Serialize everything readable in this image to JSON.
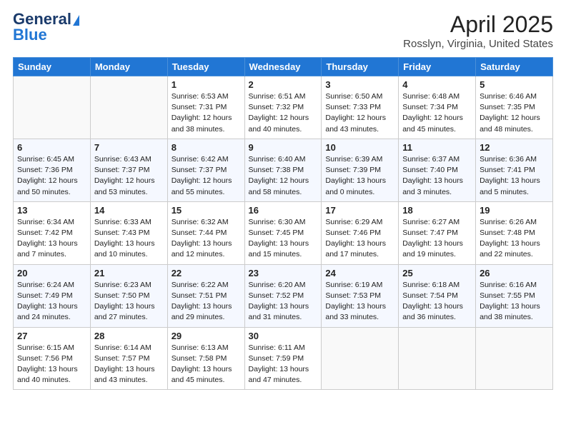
{
  "logo": {
    "general": "General",
    "blue": "Blue"
  },
  "title": {
    "month_year": "April 2025",
    "location": "Rosslyn, Virginia, United States"
  },
  "weekdays": [
    "Sunday",
    "Monday",
    "Tuesday",
    "Wednesday",
    "Thursday",
    "Friday",
    "Saturday"
  ],
  "weeks": [
    [
      {
        "day": "",
        "sunrise": "",
        "sunset": "",
        "daylight": ""
      },
      {
        "day": "",
        "sunrise": "",
        "sunset": "",
        "daylight": ""
      },
      {
        "day": "1",
        "sunrise": "Sunrise: 6:53 AM",
        "sunset": "Sunset: 7:31 PM",
        "daylight": "Daylight: 12 hours and 38 minutes."
      },
      {
        "day": "2",
        "sunrise": "Sunrise: 6:51 AM",
        "sunset": "Sunset: 7:32 PM",
        "daylight": "Daylight: 12 hours and 40 minutes."
      },
      {
        "day": "3",
        "sunrise": "Sunrise: 6:50 AM",
        "sunset": "Sunset: 7:33 PM",
        "daylight": "Daylight: 12 hours and 43 minutes."
      },
      {
        "day": "4",
        "sunrise": "Sunrise: 6:48 AM",
        "sunset": "Sunset: 7:34 PM",
        "daylight": "Daylight: 12 hours and 45 minutes."
      },
      {
        "day": "5",
        "sunrise": "Sunrise: 6:46 AM",
        "sunset": "Sunset: 7:35 PM",
        "daylight": "Daylight: 12 hours and 48 minutes."
      }
    ],
    [
      {
        "day": "6",
        "sunrise": "Sunrise: 6:45 AM",
        "sunset": "Sunset: 7:36 PM",
        "daylight": "Daylight: 12 hours and 50 minutes."
      },
      {
        "day": "7",
        "sunrise": "Sunrise: 6:43 AM",
        "sunset": "Sunset: 7:37 PM",
        "daylight": "Daylight: 12 hours and 53 minutes."
      },
      {
        "day": "8",
        "sunrise": "Sunrise: 6:42 AM",
        "sunset": "Sunset: 7:37 PM",
        "daylight": "Daylight: 12 hours and 55 minutes."
      },
      {
        "day": "9",
        "sunrise": "Sunrise: 6:40 AM",
        "sunset": "Sunset: 7:38 PM",
        "daylight": "Daylight: 12 hours and 58 minutes."
      },
      {
        "day": "10",
        "sunrise": "Sunrise: 6:39 AM",
        "sunset": "Sunset: 7:39 PM",
        "daylight": "Daylight: 13 hours and 0 minutes."
      },
      {
        "day": "11",
        "sunrise": "Sunrise: 6:37 AM",
        "sunset": "Sunset: 7:40 PM",
        "daylight": "Daylight: 13 hours and 3 minutes."
      },
      {
        "day": "12",
        "sunrise": "Sunrise: 6:36 AM",
        "sunset": "Sunset: 7:41 PM",
        "daylight": "Daylight: 13 hours and 5 minutes."
      }
    ],
    [
      {
        "day": "13",
        "sunrise": "Sunrise: 6:34 AM",
        "sunset": "Sunset: 7:42 PM",
        "daylight": "Daylight: 13 hours and 7 minutes."
      },
      {
        "day": "14",
        "sunrise": "Sunrise: 6:33 AM",
        "sunset": "Sunset: 7:43 PM",
        "daylight": "Daylight: 13 hours and 10 minutes."
      },
      {
        "day": "15",
        "sunrise": "Sunrise: 6:32 AM",
        "sunset": "Sunset: 7:44 PM",
        "daylight": "Daylight: 13 hours and 12 minutes."
      },
      {
        "day": "16",
        "sunrise": "Sunrise: 6:30 AM",
        "sunset": "Sunset: 7:45 PM",
        "daylight": "Daylight: 13 hours and 15 minutes."
      },
      {
        "day": "17",
        "sunrise": "Sunrise: 6:29 AM",
        "sunset": "Sunset: 7:46 PM",
        "daylight": "Daylight: 13 hours and 17 minutes."
      },
      {
        "day": "18",
        "sunrise": "Sunrise: 6:27 AM",
        "sunset": "Sunset: 7:47 PM",
        "daylight": "Daylight: 13 hours and 19 minutes."
      },
      {
        "day": "19",
        "sunrise": "Sunrise: 6:26 AM",
        "sunset": "Sunset: 7:48 PM",
        "daylight": "Daylight: 13 hours and 22 minutes."
      }
    ],
    [
      {
        "day": "20",
        "sunrise": "Sunrise: 6:24 AM",
        "sunset": "Sunset: 7:49 PM",
        "daylight": "Daylight: 13 hours and 24 minutes."
      },
      {
        "day": "21",
        "sunrise": "Sunrise: 6:23 AM",
        "sunset": "Sunset: 7:50 PM",
        "daylight": "Daylight: 13 hours and 27 minutes."
      },
      {
        "day": "22",
        "sunrise": "Sunrise: 6:22 AM",
        "sunset": "Sunset: 7:51 PM",
        "daylight": "Daylight: 13 hours and 29 minutes."
      },
      {
        "day": "23",
        "sunrise": "Sunrise: 6:20 AM",
        "sunset": "Sunset: 7:52 PM",
        "daylight": "Daylight: 13 hours and 31 minutes."
      },
      {
        "day": "24",
        "sunrise": "Sunrise: 6:19 AM",
        "sunset": "Sunset: 7:53 PM",
        "daylight": "Daylight: 13 hours and 33 minutes."
      },
      {
        "day": "25",
        "sunrise": "Sunrise: 6:18 AM",
        "sunset": "Sunset: 7:54 PM",
        "daylight": "Daylight: 13 hours and 36 minutes."
      },
      {
        "day": "26",
        "sunrise": "Sunrise: 6:16 AM",
        "sunset": "Sunset: 7:55 PM",
        "daylight": "Daylight: 13 hours and 38 minutes."
      }
    ],
    [
      {
        "day": "27",
        "sunrise": "Sunrise: 6:15 AM",
        "sunset": "Sunset: 7:56 PM",
        "daylight": "Daylight: 13 hours and 40 minutes."
      },
      {
        "day": "28",
        "sunrise": "Sunrise: 6:14 AM",
        "sunset": "Sunset: 7:57 PM",
        "daylight": "Daylight: 13 hours and 43 minutes."
      },
      {
        "day": "29",
        "sunrise": "Sunrise: 6:13 AM",
        "sunset": "Sunset: 7:58 PM",
        "daylight": "Daylight: 13 hours and 45 minutes."
      },
      {
        "day": "30",
        "sunrise": "Sunrise: 6:11 AM",
        "sunset": "Sunset: 7:59 PM",
        "daylight": "Daylight: 13 hours and 47 minutes."
      },
      {
        "day": "",
        "sunrise": "",
        "sunset": "",
        "daylight": ""
      },
      {
        "day": "",
        "sunrise": "",
        "sunset": "",
        "daylight": ""
      },
      {
        "day": "",
        "sunrise": "",
        "sunset": "",
        "daylight": ""
      }
    ]
  ]
}
